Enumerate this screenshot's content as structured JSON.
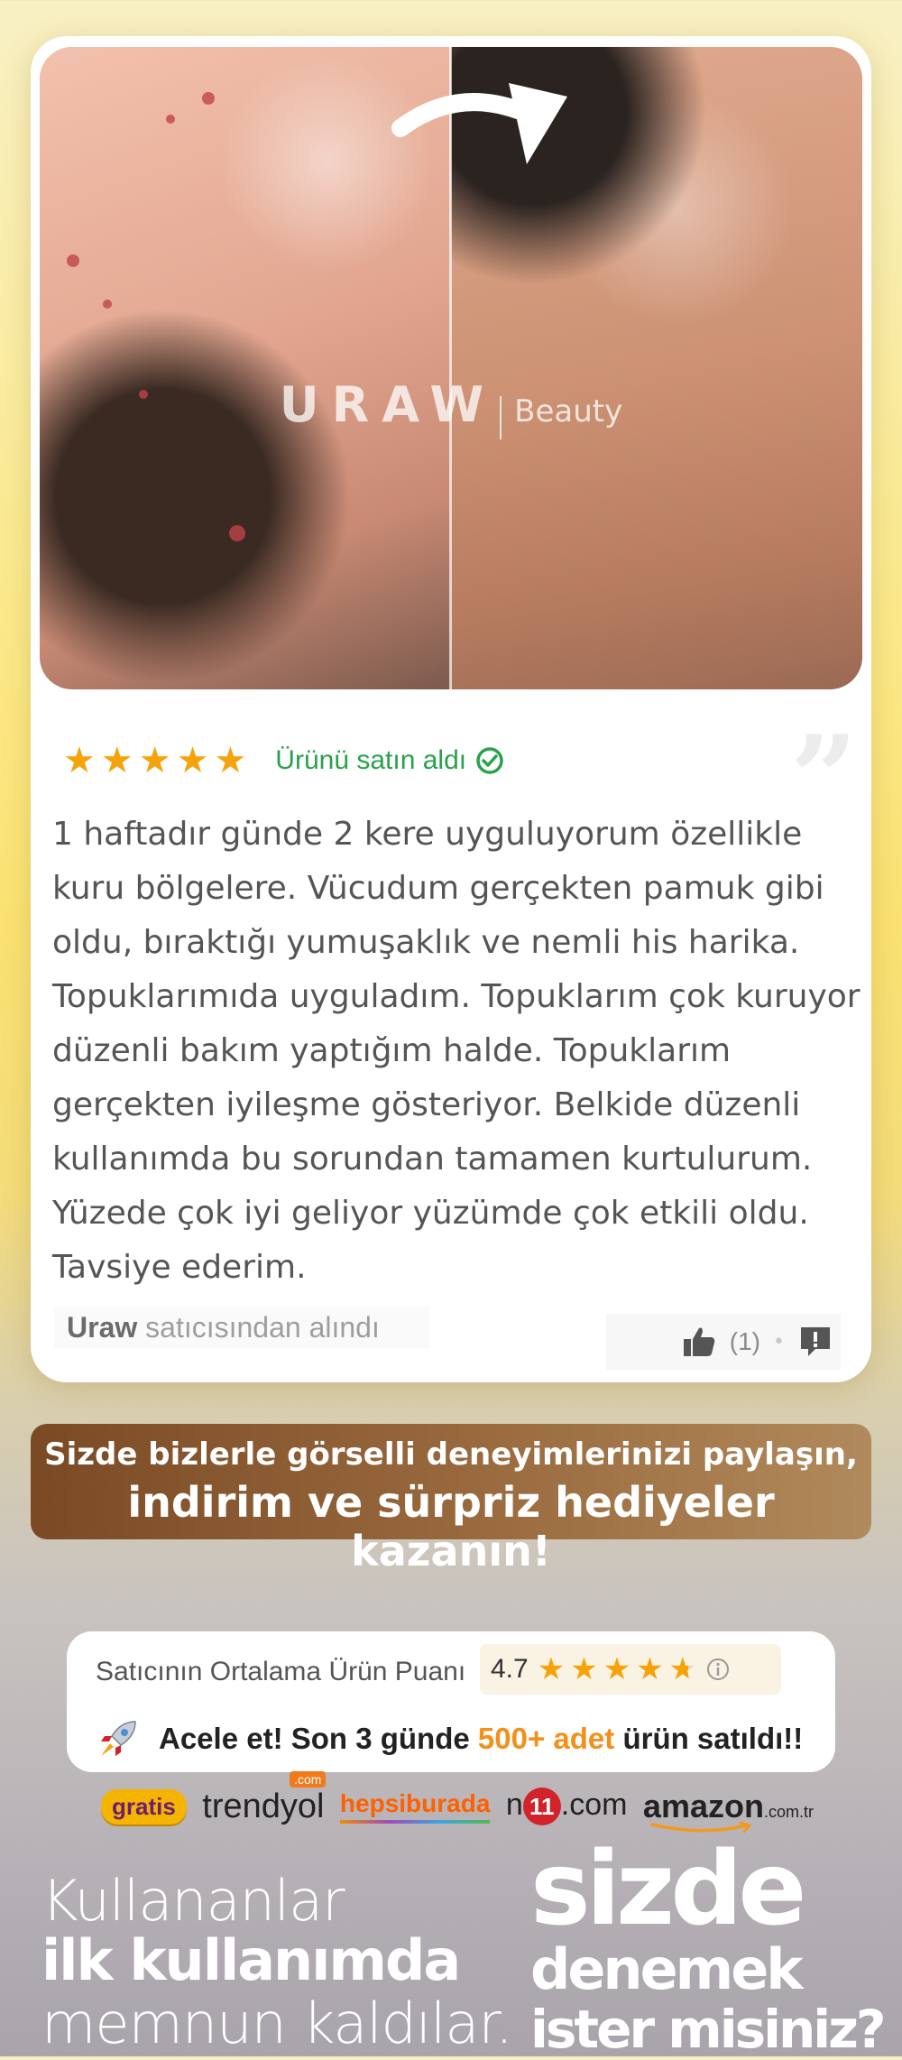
{
  "brand": {
    "name": "URAW",
    "sub": "Beauty"
  },
  "review": {
    "stars": 5,
    "verified_label": "Ürünü satın aldı",
    "text": "1 haftadır günde 2 kere uyguluyorum özellikle kuru bölgelere. Vücudum gerçekten pamuk gibi oldu, bıraktığı yumuşaklık ve nemli his harika. Topuklarımıda uyguladım. Topuklarım çok kuruyor düzenli bakım yaptığım halde. Topuklarım gerçekten iyileşme gösteriyor. Belkide düzenli kullanımda bu sorundan tamamen kurtulurum. Yüzede çok iyi geliyor yüzümde çok etkili oldu. Tavsiye ederim.",
    "seller_name": "Uraw",
    "seller_suffix": "satıcısından alındı",
    "like_count": "(1)"
  },
  "promo": {
    "line1": "Sizde bizlerle görselli deneyimlerinizi paylaşın,",
    "line2": "indirim ve sürpriz hediyeler kazanın!"
  },
  "rating": {
    "label": "Satıcının Ortalama Ürün Puanı",
    "score": "4.7",
    "hurry_prefix": "Acele et! Son 3 günde",
    "hurry_highlight": "500+ adet",
    "hurry_suffix": "ürün satıldı!!"
  },
  "stores": {
    "gratis": "gratis",
    "trendyol": "trendyol",
    "trendyol_com": ".com",
    "hepsiburada": "hepsiburada",
    "n11_prefix": "n",
    "n11_eleven": "11",
    "n11_suffix": ".com",
    "amazon": "amazon",
    "amazon_tld": ".com.tr"
  },
  "slogan_left": {
    "line1": "Kullananlar",
    "line2": "ilk kullanımda",
    "line3": "memnun kaldılar."
  },
  "slogan_right": {
    "line1": "sizde",
    "line2": "denemek",
    "line3": "ister misiniz?"
  },
  "colors": {
    "star": "#f6a30a",
    "verified": "#27a24a",
    "highlight": "#f3901a"
  }
}
